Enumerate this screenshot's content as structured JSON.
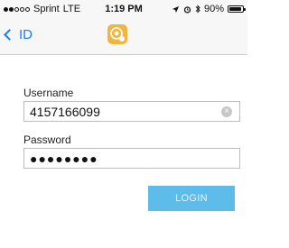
{
  "status_bar": {
    "carrier": "Sprint",
    "network": "LTE",
    "time": "1:19 PM",
    "battery": "90%",
    "battery_level": 0.9
  },
  "nav": {
    "back_label": "ID"
  },
  "form": {
    "username_label": "Username",
    "username_value": "4157166099",
    "password_label": "Password",
    "password_masked": "●●●●●●●●",
    "login_label": "LOGIN"
  },
  "colors": {
    "accent": "#1a7cf5",
    "app_icon": "#f2b640",
    "login_button": "#5dbcea"
  }
}
